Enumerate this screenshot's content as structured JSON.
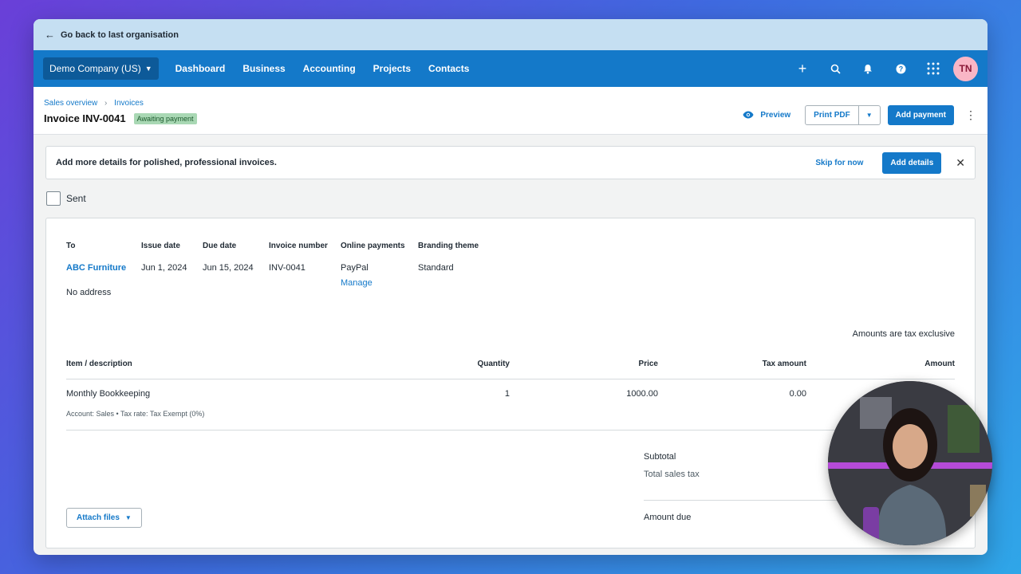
{
  "backbar": {
    "label": "Go back to last organisation"
  },
  "nav": {
    "org": "Demo Company (US)",
    "links": [
      "Dashboard",
      "Business",
      "Accounting",
      "Projects",
      "Contacts"
    ],
    "avatar_initials": "TN",
    "icons": [
      "plus-icon",
      "search-icon",
      "bell-icon",
      "help-icon",
      "app-grid-icon"
    ]
  },
  "header": {
    "breadcrumbs": [
      "Sales overview",
      "Invoices"
    ],
    "title": "Invoice INV-0041",
    "status": "Awaiting payment",
    "preview": "Preview",
    "print_pdf": "Print PDF",
    "add_payment": "Add payment"
  },
  "banner": {
    "text": "Add more details for polished, professional invoices.",
    "skip": "Skip for now",
    "add_details": "Add details"
  },
  "sent": {
    "label": "Sent"
  },
  "invoice": {
    "labels": {
      "to": "To",
      "issue_date": "Issue date",
      "due_date": "Due date",
      "invoice_number": "Invoice number",
      "online_payments": "Online payments",
      "branding_theme": "Branding theme"
    },
    "customer": "ABC Furniture",
    "address": "No address",
    "issue_date": "Jun 1, 2024",
    "due_date": "Jun 15, 2024",
    "invoice_number": "INV-0041",
    "online_payments": "PayPal",
    "manage": "Manage",
    "branding_theme": "Standard",
    "tax_note": "Amounts are tax exclusive",
    "columns": [
      "Item / description",
      "Quantity",
      "Price",
      "Tax amount",
      "Amount"
    ],
    "line": {
      "description": "Monthly Bookkeeping",
      "quantity": "1",
      "price": "1000.00",
      "tax_amount": "0.00",
      "detail": "Account: Sales • Tax rate: Tax Exempt (0%)"
    },
    "totals": {
      "subtotal": "Subtotal",
      "total_sales_tax": "Total sales tax",
      "amount_due": "Amount due"
    },
    "attach_files": "Attach files"
  },
  "colors": {
    "accent": "#1479c9",
    "nav_bg": "#1479c9",
    "status_badge": "#a9d8b4"
  }
}
